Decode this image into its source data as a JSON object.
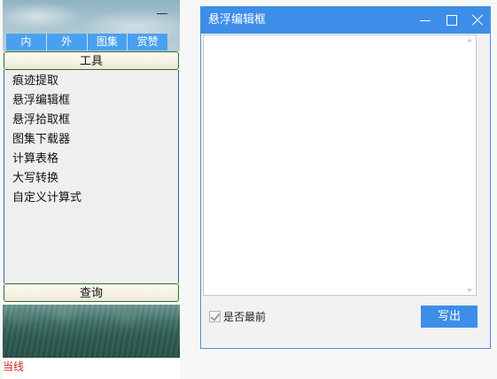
{
  "left_panel": {
    "tabs": [
      {
        "label": "内"
      },
      {
        "label": "外"
      },
      {
        "label": "图集"
      },
      {
        "label": "赏赞"
      }
    ],
    "tools_button": "工具",
    "tool_items": [
      {
        "label": "痕迹提取"
      },
      {
        "label": "悬浮编辑框"
      },
      {
        "label": "悬浮拾取框"
      },
      {
        "label": "图集下载器"
      },
      {
        "label": "计算表格"
      },
      {
        "label": "大写转换"
      },
      {
        "label": "自定义计算式"
      }
    ],
    "query_button": "查询",
    "status_text": "当线"
  },
  "dialog": {
    "title": "悬浮编辑框",
    "editor_value": "",
    "topmost_label": "是否最前",
    "topmost_checked": true,
    "write_button": "写出"
  },
  "colors": {
    "accent": "#3d8ee8",
    "tab_blue": "#4aa0f0",
    "status_red": "#d82020"
  },
  "icons": {
    "minimize": "minimize-icon",
    "maximize": "maximize-icon",
    "close": "close-icon"
  }
}
